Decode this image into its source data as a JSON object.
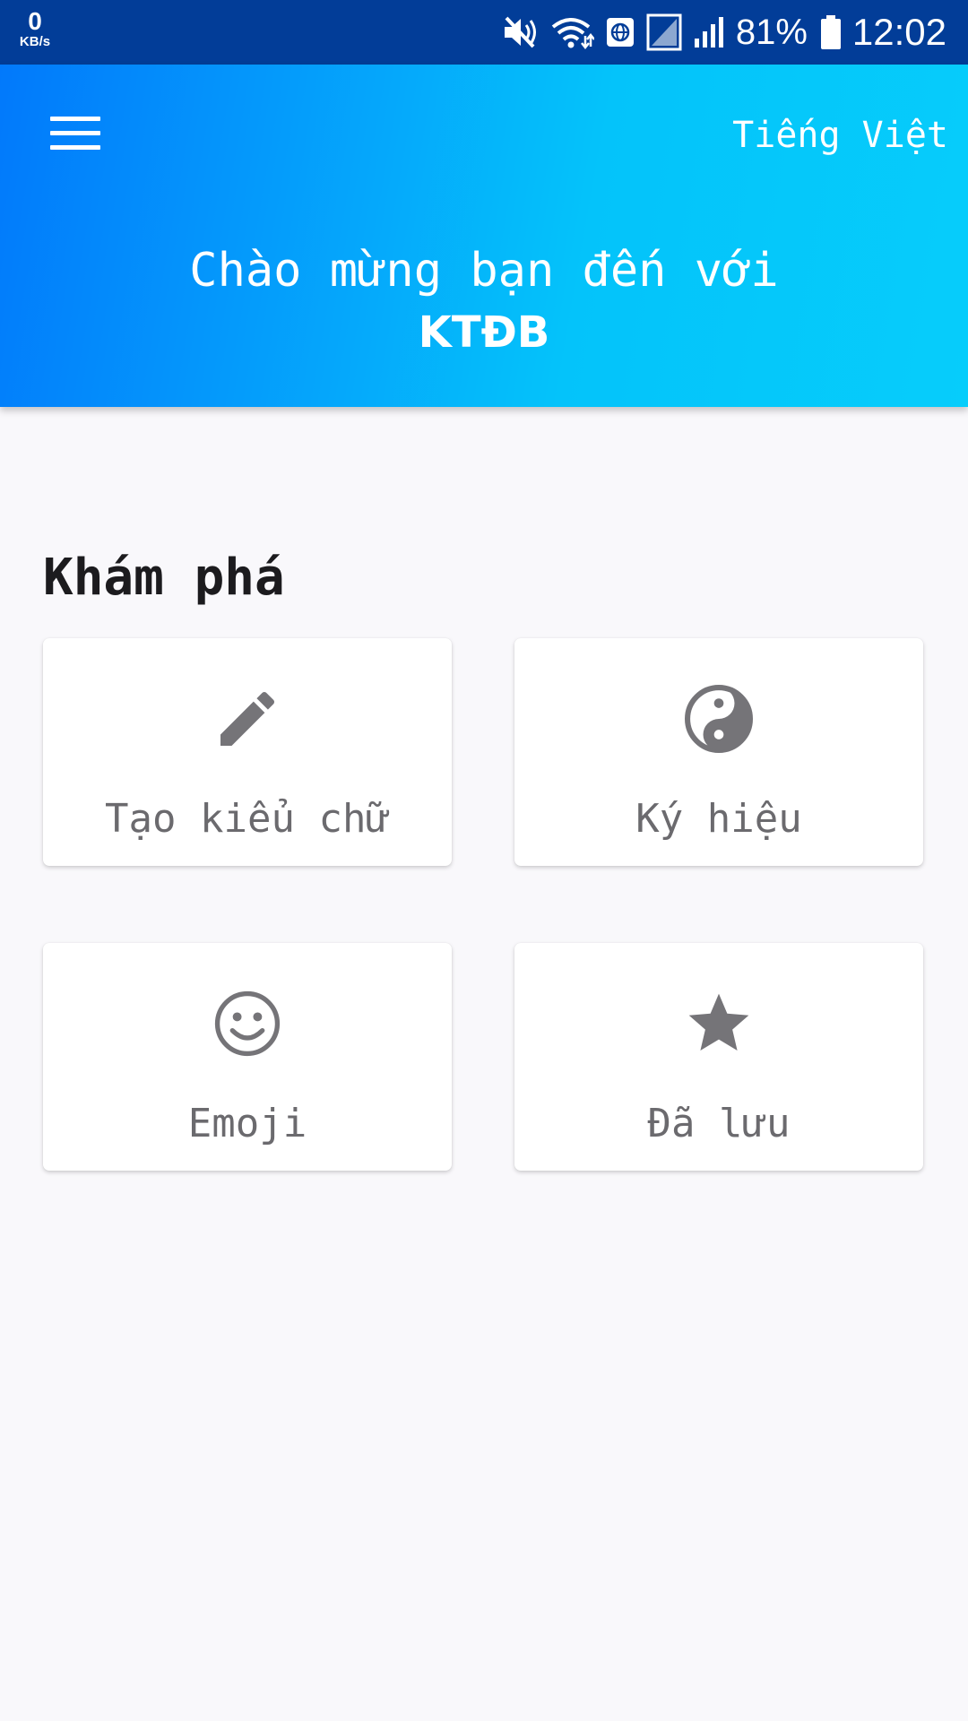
{
  "status_bar": {
    "net_speed_value": "0",
    "net_speed_unit": "KB/s",
    "battery_percent": "81%",
    "time": "12:02",
    "icons": [
      "mute-icon",
      "wifi-icon",
      "vpn-globe-icon",
      "no-sim-icon",
      "signal-icon",
      "battery-icon"
    ]
  },
  "header": {
    "menu_icon": "hamburger-menu-icon",
    "language_label": "Tiếng Việt",
    "welcome_line1": "Chào mừng bạn đến với",
    "welcome_line2": "KTĐB"
  },
  "explore": {
    "title": "Khám phá",
    "cards": [
      {
        "label": "Tạo kiểu chữ",
        "icon": "pencil-icon"
      },
      {
        "label": "Ký hiệu",
        "icon": "yin-yang-icon"
      },
      {
        "label": "Emoji",
        "icon": "smiley-icon"
      },
      {
        "label": "Đã lưu",
        "icon": "star-icon"
      }
    ]
  },
  "colors": {
    "status_bar_bg": "#023d98",
    "header_gradient_start": "#0279fb",
    "header_gradient_end": "#06cdfb",
    "page_bg": "#f9f8fb",
    "icon_gray": "#757478",
    "label_gray": "#6b6a6e"
  }
}
